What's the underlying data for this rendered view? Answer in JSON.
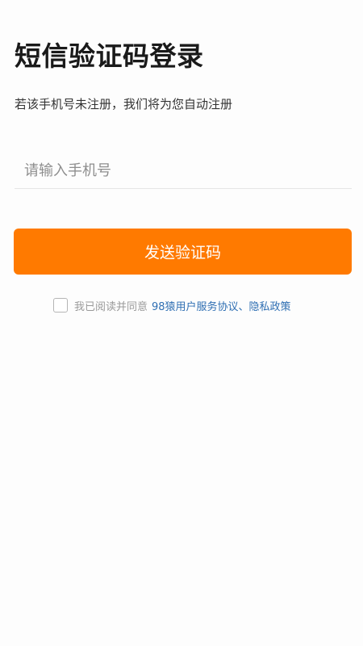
{
  "header": {
    "title": "短信验证码登录",
    "subtitle": "若该手机号未注册，我们将为您自动注册"
  },
  "phone_input": {
    "placeholder": "请输入手机号",
    "value": ""
  },
  "send_button": {
    "label": "发送验证码"
  },
  "agreement": {
    "checked": false,
    "text": "我已阅读并同意",
    "link_text": "98猿用户服务协议、隐私政策"
  },
  "colors": {
    "accent": "#ff7a00",
    "link": "#2f6fb3",
    "background": "#fdfdfd"
  }
}
